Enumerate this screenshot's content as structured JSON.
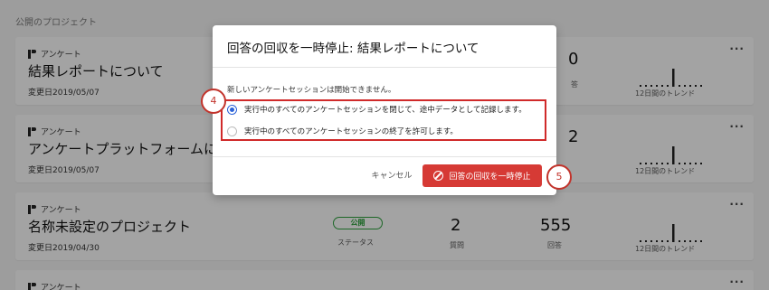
{
  "page": {
    "section_title": "公開のプロジェクト",
    "cards": [
      {
        "type": "アンケート",
        "name": "結果レポートについて",
        "modified": "変更日2019/05/07",
        "partial_number": "0",
        "partial_label": "答",
        "trend_label": "12日間のトレンド"
      },
      {
        "type": "アンケート",
        "name": "アンケートプラットフォームにつ",
        "modified": "変更日2019/05/07",
        "partial_number": "2",
        "partial_label": "",
        "trend_label": "12日間のトレンド"
      },
      {
        "type": "アンケート",
        "name": "名称未設定のプロジェクト",
        "modified": "変更日2019/04/30",
        "status_badge": "公開",
        "status_label": "ステータス",
        "questions_value": "2",
        "questions_label": "質問",
        "responses_value": "555",
        "responses_label": "回答",
        "trend_label": "12日間のトレンド"
      },
      {
        "type": "アンケート"
      }
    ],
    "more_icon": "more-horizontal-icon"
  },
  "modal": {
    "title": "回答の回収を一時停止: 結果レポートについて",
    "description": "新しいアンケートセッションは開始できません。",
    "options": [
      {
        "label": "実行中のすべてのアンケートセッションを閉じて、途中データとして記録します。",
        "checked": true
      },
      {
        "label": "実行中のすべてのアンケートセッションの終了を許可します。",
        "checked": false
      }
    ],
    "cancel_label": "キャンセル",
    "confirm_label": "回答の回収を一時停止",
    "confirm_icon": "ban-icon",
    "accent_color": "#d63a35",
    "radio_color": "#2b62d8"
  },
  "annotations": {
    "callout_options": "4",
    "callout_button": "5",
    "color": "#c2332b"
  }
}
